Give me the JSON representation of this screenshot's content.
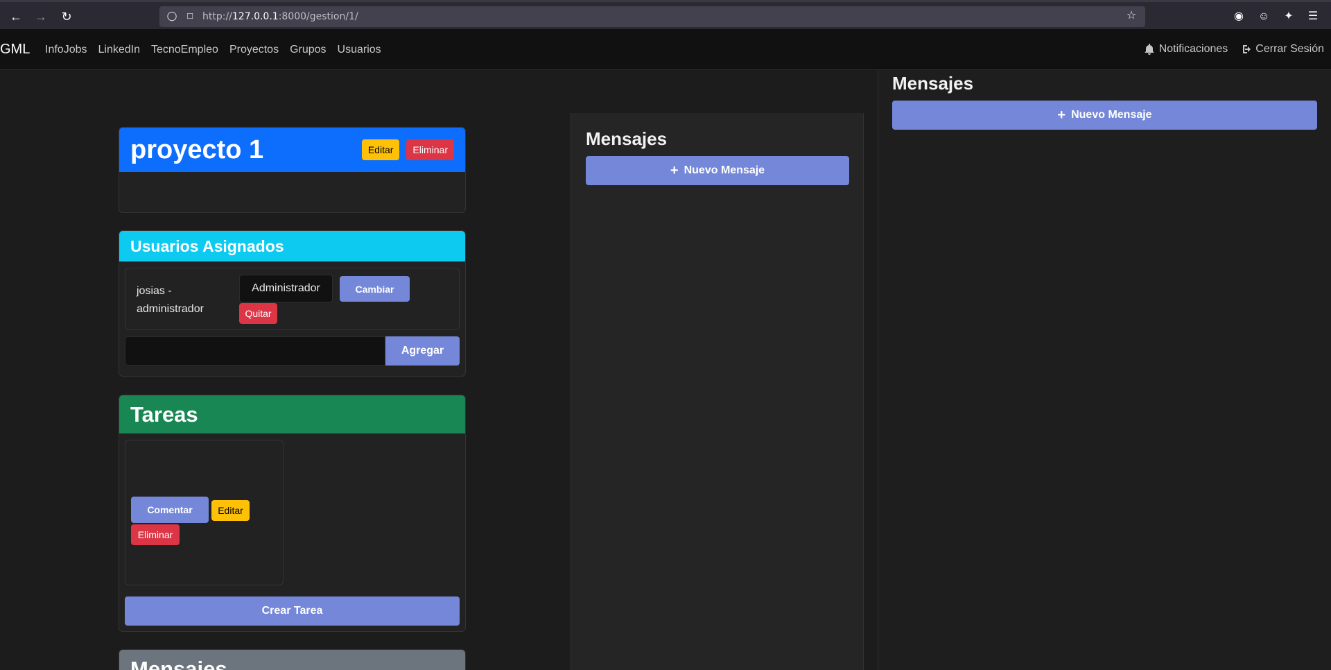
{
  "browser": {
    "url_prefix": "http://",
    "url_host": "127.0.0.1",
    "url_rest": ":8000/gestion/1/"
  },
  "navbar": {
    "brand": "GML",
    "links": [
      "InfoJobs",
      "LinkedIn",
      "TecnoEmpleo",
      "Proyectos",
      "Grupos",
      "Usuarios"
    ],
    "notifications": "Notificaciones",
    "logout": "Cerrar Sesión"
  },
  "project": {
    "title": "proyecto 1",
    "edit": "Editar",
    "delete": "Eliminar"
  },
  "users": {
    "title": "Usuarios Asignados",
    "rows": [
      {
        "name": "josias - administrador",
        "role": "Administrador",
        "change": "Cambiar",
        "remove": "Quitar"
      }
    ],
    "add_label": "Agregar"
  },
  "tasks": {
    "title": "Tareas",
    "comment": "Comentar",
    "edit": "Editar",
    "delete": "Eliminar",
    "create": "Crear Tarea"
  },
  "messages_card": {
    "title": "Mensajes"
  },
  "mid_panel": {
    "title": "Mensajes",
    "new_message": "Nuevo Mensaje"
  },
  "right_panel": {
    "title": "Mensajes",
    "new_message": "Nuevo Mensaje"
  }
}
